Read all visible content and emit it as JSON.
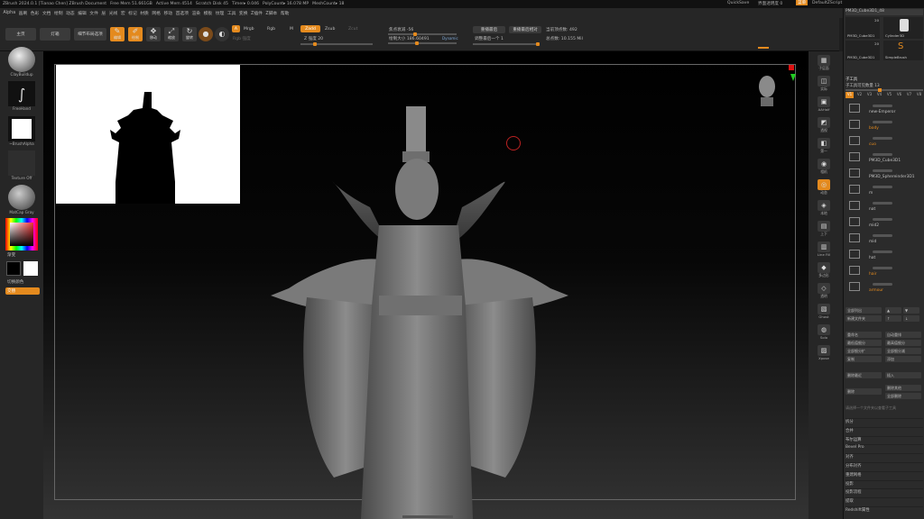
{
  "titlebar": {
    "title": "ZBrush 2024.0.1 [Tianao Chen]  ZBrush Document",
    "free_mem": "Free Mem 51.661GB",
    "active_mem": "Active Mem 4514",
    "scratch": "Scratch Disk 45",
    "timer": "Timer▸ 0.046",
    "polycount": "PolyCount▸ 16.078 MP",
    "meshcount": "MeshCount▸ 18",
    "quicksave": "QuickSave",
    "transparency": "界面透明度 0",
    "menus_btn": "菜单",
    "script": "DefaultZScript"
  },
  "menu": [
    "Alpha",
    "画刷",
    "色彩",
    "文档",
    "绘制",
    "动态",
    "编辑",
    "文件",
    "层",
    "光线",
    "宏",
    "标记",
    "材质",
    "网格",
    "移动",
    "首选项",
    "渲染",
    "模板",
    "纹理",
    "工具",
    "变换",
    "Z插件",
    "Z脚本",
    "帮助"
  ],
  "toolbar": {
    "home": "主页",
    "lightbox": "灯箱",
    "scene": "细节布局选项",
    "edit": "编辑",
    "draw": "绘制",
    "move": "移动",
    "scale": "缩放",
    "rotate": "旋转",
    "a": "A",
    "mrgb": "Mrgb",
    "rgb": "Rgb",
    "m": "M",
    "zadd": "Zadd",
    "zsub": "Zsub",
    "zcut": "Zcut",
    "rgb_intensity": "Rgb 强度",
    "z_intensity": "Z 强度 20",
    "focal_shift": "焦点衰减 -56",
    "draw_size": "绘制大小 186.60491",
    "dynamic": "Dynamic",
    "replay_last": "重播最后",
    "replay_last_rel": "重播最后相对",
    "adjust_last": "调整最后一个 1",
    "active_points": "当前顶点数: 492",
    "total_points": "总点数: 10.155 Mil"
  },
  "left_shelf": {
    "brush": "ClayBuildup",
    "stroke": "FreeHand",
    "alpha": "~BrushAlpha",
    "texture": "Texture Off",
    "material": "MatCap Gray",
    "gradient": "渐变",
    "switch": "切换颜色",
    "alternate": "交替"
  },
  "right_shelf": [
    "子层面",
    "实际",
    "AAHalf",
    "透视",
    "第一",
    "相机",
    "动态",
    "本地",
    "上下",
    "Line Fill",
    "多边形",
    "透明",
    "Ghost",
    "Solo",
    "Xpose"
  ],
  "panel": {
    "tool_current": "PM3D_Cube3D1_48",
    "tool_count": "20",
    "thumbs": [
      "PM3D_Cube3D1",
      "Cylinder3D",
      "SimpleBrush",
      "PM3D_Cube3D1"
    ],
    "thumb_nums": [
      "20",
      "20",
      "20"
    ],
    "subtool_title": "子工具",
    "visible_count": "子工具可见数量 13",
    "versions": [
      "V1",
      "V2",
      "V3",
      "V4",
      "V5",
      "V6",
      "V7",
      "V8"
    ],
    "subtools": [
      {
        "name": "new-Emperor",
        "orange": false
      },
      {
        "name": "body",
        "orange": true
      },
      {
        "name": "cuo",
        "orange": true
      },
      {
        "name": "PM3D_Cube3D1",
        "orange": false
      },
      {
        "name": "PM3D_Sphereinder3D1",
        "orange": false
      },
      {
        "name": "m",
        "orange": false
      },
      {
        "name": "nat",
        "orange": false
      },
      {
        "name": "mid2",
        "orange": false
      },
      {
        "name": "mid",
        "orange": false
      },
      {
        "name": "hat",
        "orange": false
      },
      {
        "name": "hair",
        "orange": true
      },
      {
        "name": "armour",
        "orange": true
      }
    ],
    "list_all": "全部列出",
    "new_folder": "新建文件夹",
    "ops_left": [
      "重命名",
      "最低值细分",
      "全部细分扩",
      "复制",
      "",
      "删除最近"
    ],
    "ops_right": [
      "自动重排",
      "最高值细分",
      "全部细分减",
      "添加",
      "",
      "插入"
    ],
    "ops2_left": [
      "删除"
    ],
    "ops2_right": [
      "删除其他",
      "全部删除"
    ],
    "hint": "请选择一个文件夹以查看子工具",
    "menu": [
      "拆分",
      "合并",
      "布尔运算",
      "Bevel Pro",
      "对齐",
      "分布对齐",
      "重建网格",
      "投影",
      "投影流程",
      "提取",
      "Redshift属性"
    ]
  }
}
